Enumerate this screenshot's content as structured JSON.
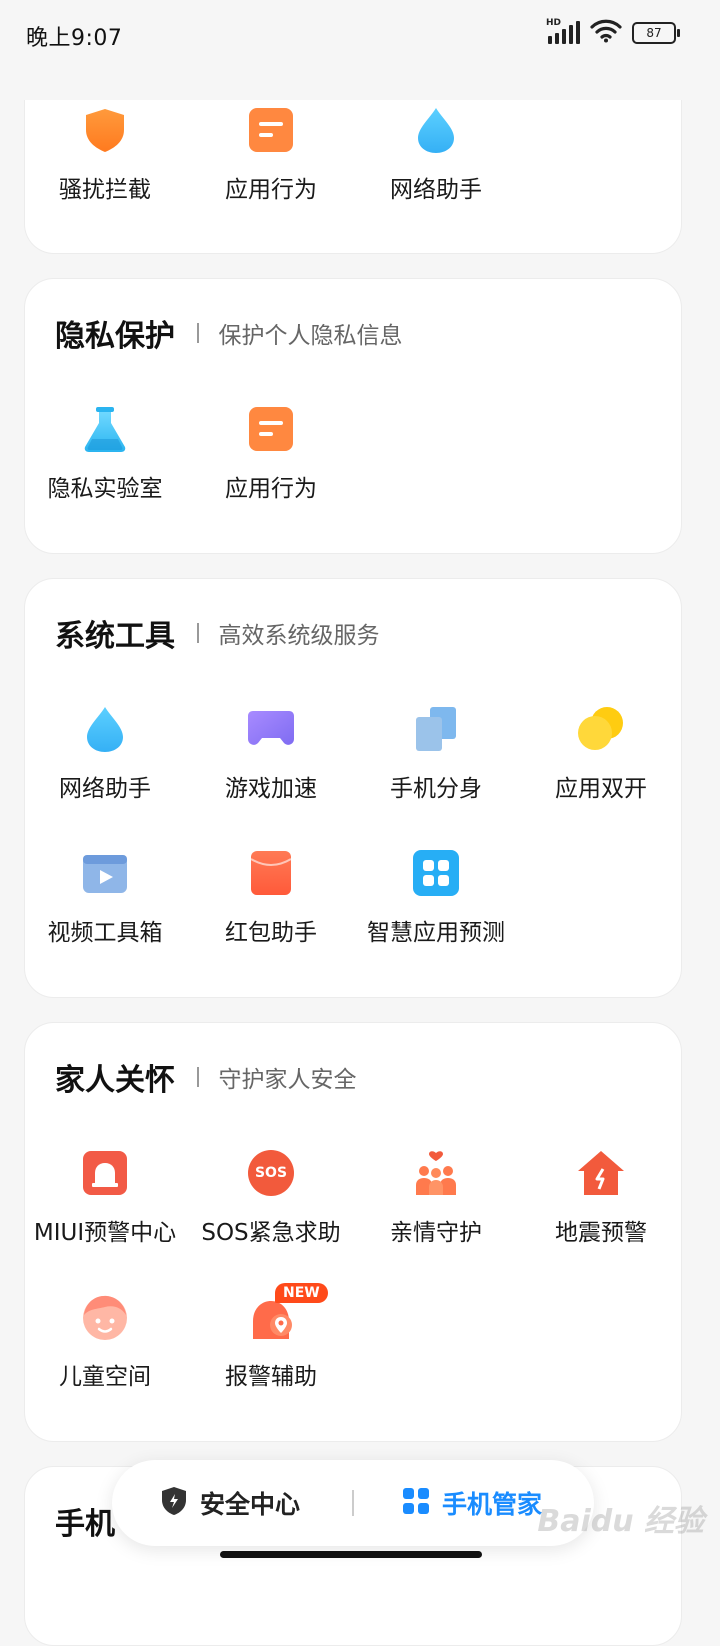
{
  "status": {
    "time": "晚上9:07",
    "battery": "87",
    "hd_label": "HD"
  },
  "top_card": {
    "items": [
      {
        "label": "骚扰拦截",
        "icon": "shield-icon"
      },
      {
        "label": "应用行为",
        "icon": "app-behavior-icon"
      },
      {
        "label": "网络助手",
        "icon": "water-drop-icon"
      }
    ]
  },
  "privacy": {
    "title": "隐私保护",
    "subtitle": "保护个人隐私信息",
    "items": [
      {
        "label": "隐私实验室",
        "icon": "flask-icon"
      },
      {
        "label": "应用行为",
        "icon": "app-behavior-icon"
      }
    ]
  },
  "tools": {
    "title": "系统工具",
    "subtitle": "高效系统级服务",
    "items": [
      {
        "label": "网络助手",
        "icon": "water-drop-icon"
      },
      {
        "label": "游戏加速",
        "icon": "gamepad-icon"
      },
      {
        "label": "手机分身",
        "icon": "dual-phone-icon"
      },
      {
        "label": "应用双开",
        "icon": "dual-app-icon"
      },
      {
        "label": "视频工具箱",
        "icon": "video-toolbox-icon"
      },
      {
        "label": "红包助手",
        "icon": "red-envelope-icon"
      },
      {
        "label": "智慧应用预测",
        "icon": "app-grid-icon"
      }
    ]
  },
  "family": {
    "title": "家人关怀",
    "subtitle": "守护家人安全",
    "items": [
      {
        "label": "MIUI预警中心",
        "icon": "alarm-bell-icon"
      },
      {
        "label": "SOS紧急求助",
        "icon": "sos-icon",
        "icon_text": "SOS"
      },
      {
        "label": "亲情守护",
        "icon": "family-icon"
      },
      {
        "label": "地震预警",
        "icon": "earthquake-house-icon"
      },
      {
        "label": "儿童空间",
        "icon": "child-face-icon"
      },
      {
        "label": "报警辅助",
        "icon": "alarm-assist-icon",
        "badge": "NEW"
      }
    ]
  },
  "next_card": {
    "title": "手机"
  },
  "bottom_nav": {
    "tabs": [
      {
        "label": "安全中心",
        "icon": "security-shield-icon",
        "color": "#222222"
      },
      {
        "label": "手机管家",
        "icon": "grid-icon",
        "color": "#1a8cff"
      }
    ]
  },
  "watermark": "Baidu 经验",
  "colors": {
    "accent_blue": "#1a8cff",
    "orange": "#ff7a3d",
    "red": "#f25a46"
  }
}
